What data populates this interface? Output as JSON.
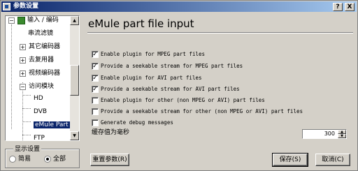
{
  "window": {
    "title": "参数设置",
    "help_btn": "?",
    "close_btn": "X"
  },
  "tree": {
    "items": [
      {
        "label": "输入 / 编码",
        "expander": "−"
      },
      {
        "label": "串流滤镜",
        "expander": ""
      },
      {
        "label": "其它编码器",
        "expander": "+"
      },
      {
        "label": "去复用器",
        "expander": "+"
      },
      {
        "label": "视频编码器",
        "expander": "+"
      },
      {
        "label": "访问模块",
        "expander": "−"
      },
      {
        "label": "HD",
        "expander": ""
      },
      {
        "label": "DVB",
        "expander": ""
      },
      {
        "label": "eMule Part",
        "expander": "",
        "selected": true
      },
      {
        "label": "FTP",
        "expander": ""
      }
    ]
  },
  "display_settings": {
    "title": "显示设置",
    "options": [
      {
        "label": "简易",
        "selected": false
      },
      {
        "label": "全部",
        "selected": true
      }
    ]
  },
  "panel": {
    "title": "eMule part file input",
    "options": [
      {
        "label": "Enable plugin for MPEG part files",
        "checked": true
      },
      {
        "label": "Provide a seekable stream for MPEG part files",
        "checked": true
      },
      {
        "label": "Enable plugin for AVI part files",
        "checked": true
      },
      {
        "label": "Provide a seekable stream for AVI part files",
        "checked": true
      },
      {
        "label": "Enable plugin for other (non MPEG or AVI) part files",
        "checked": false
      },
      {
        "label": "Provide a seekable stream for other (non MPEG or AVI) part files",
        "checked": false
      },
      {
        "label": "Generate debug messages",
        "checked": false
      }
    ],
    "cache_label": "缓存值为毫秒",
    "cache_value": "300"
  },
  "buttons": {
    "reset": "重置参数(R)",
    "save": "保存(S)",
    "cancel": "取消(C)"
  }
}
